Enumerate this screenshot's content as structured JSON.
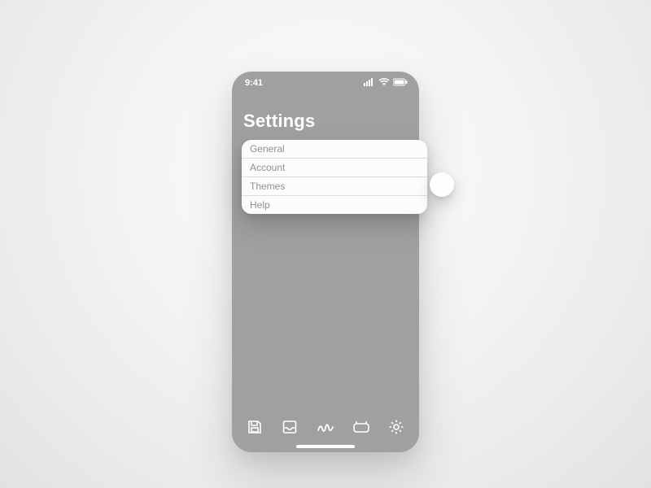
{
  "status": {
    "time": "9:41"
  },
  "page": {
    "title": "Settings"
  },
  "menu": {
    "items": [
      {
        "label": "General"
      },
      {
        "label": "Account"
      },
      {
        "label": "Themes"
      },
      {
        "label": "Help"
      }
    ]
  },
  "tabs": [
    {
      "name": "save"
    },
    {
      "name": "inbox"
    },
    {
      "name": "scribble"
    },
    {
      "name": "media"
    },
    {
      "name": "settings"
    }
  ]
}
